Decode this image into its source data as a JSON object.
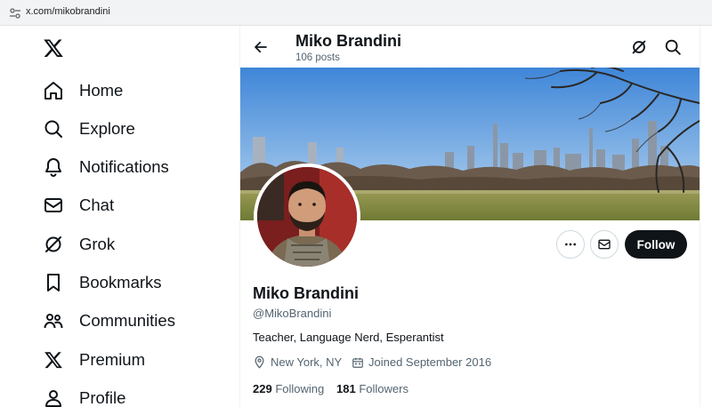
{
  "browser": {
    "url": "x.com/mikobrandini"
  },
  "nav": [
    {
      "label": "Home",
      "icon": "home-icon"
    },
    {
      "label": "Explore",
      "icon": "search-icon"
    },
    {
      "label": "Notifications",
      "icon": "bell-icon"
    },
    {
      "label": "Chat",
      "icon": "mail-icon"
    },
    {
      "label": "Grok",
      "icon": "grok-icon"
    },
    {
      "label": "Bookmarks",
      "icon": "bookmark-icon"
    },
    {
      "label": "Communities",
      "icon": "communities-icon"
    },
    {
      "label": "Premium",
      "icon": "x-logo-icon"
    },
    {
      "label": "Profile",
      "icon": "person-icon"
    }
  ],
  "header": {
    "name": "Miko Brandini",
    "posts": "106 posts"
  },
  "profile": {
    "name": "Miko Brandini",
    "handle": "@MikoBrandini",
    "bio": "Teacher, Language Nerd, Esperantist",
    "location": "New York, NY",
    "joined": "Joined September 2016",
    "following_count": "229",
    "following_label": "Following",
    "followers_count": "181",
    "followers_label": "Followers"
  },
  "actions": {
    "follow_label": "Follow"
  },
  "colors": {
    "text": "#0f1419",
    "muted": "#536471",
    "border": "#cfd9de",
    "button": "#0f1419"
  }
}
